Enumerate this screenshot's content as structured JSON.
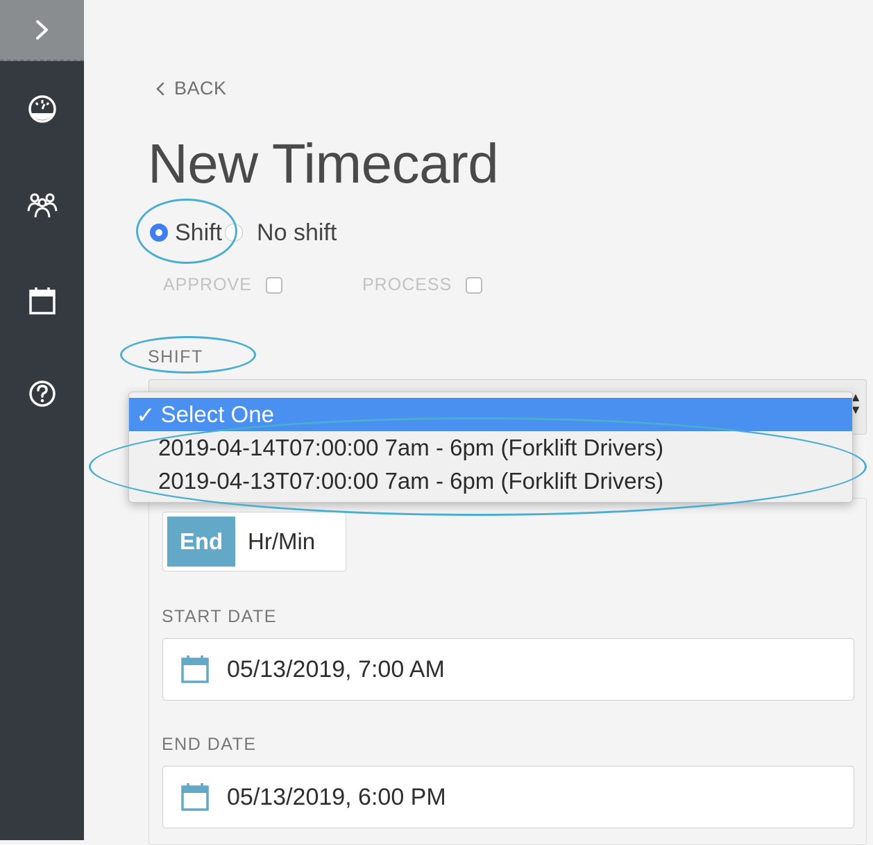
{
  "sidebar": {
    "toggle_icon": "chevron-right-icon",
    "items": [
      {
        "icon": "dashboard-gauge-icon"
      },
      {
        "icon": "users-group-icon"
      },
      {
        "icon": "calendar-icon"
      },
      {
        "icon": "help-question-icon"
      }
    ]
  },
  "nav": {
    "back_label": "BACK"
  },
  "page": {
    "title": "New Timecard"
  },
  "mode": {
    "options": [
      {
        "label": "Shift",
        "checked": true
      },
      {
        "label": "No shift",
        "checked": false
      }
    ]
  },
  "flags": {
    "approve_label": "APPROVE",
    "process_label": "PROCESS"
  },
  "shift": {
    "label": "SHIFT",
    "dropdown_options": [
      {
        "label": "Select One",
        "selected": true
      },
      {
        "label": "2019-04-14T07:00:00 7am - 6pm (Forklift Drivers)",
        "selected": false
      },
      {
        "label": "2019-04-13T07:00:00 7am - 6pm (Forklift Drivers)",
        "selected": false
      }
    ]
  },
  "duration_toggle": {
    "end_label": "End",
    "hrmin_label": "Hr/Min"
  },
  "start_date": {
    "label": "START DATE",
    "value": "05/13/2019, 7:00 AM"
  },
  "end_date": {
    "label": "END DATE",
    "value": "05/13/2019, 6:00 PM"
  },
  "colors": {
    "accent": "#3f7ef0",
    "toggle_active": "#63a8c7",
    "annotation": "#4aaed1",
    "sidebar": "#353a40"
  }
}
